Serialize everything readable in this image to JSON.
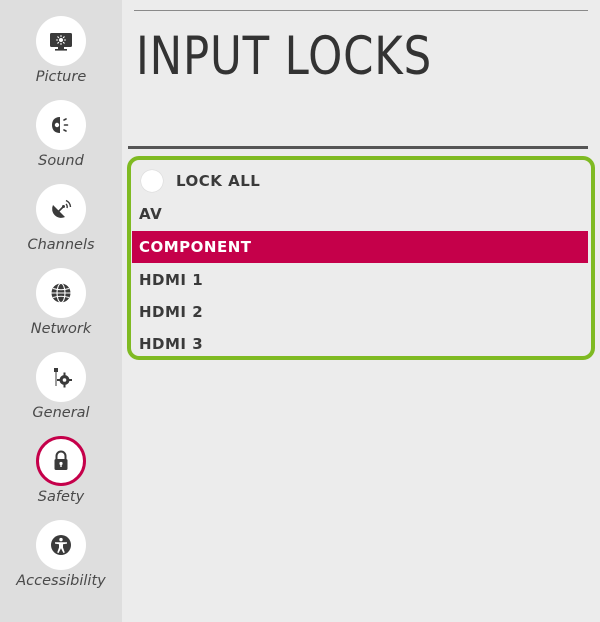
{
  "sidebar": {
    "items": [
      {
        "label": "Picture",
        "icon": "picture-icon",
        "selected": false
      },
      {
        "label": "Sound",
        "icon": "sound-icon",
        "selected": false
      },
      {
        "label": "Channels",
        "icon": "channels-icon",
        "selected": false
      },
      {
        "label": "Network",
        "icon": "network-icon",
        "selected": false
      },
      {
        "label": "General",
        "icon": "general-icon",
        "selected": false
      },
      {
        "label": "Safety",
        "icon": "lock-icon",
        "selected": true
      },
      {
        "label": "Accessibility",
        "icon": "accessibility-icon",
        "selected": false
      }
    ]
  },
  "main": {
    "title": "INPUT LOCKS",
    "lock_all": {
      "label": "LOCK ALL",
      "checked": false
    },
    "inputs": [
      {
        "label": "AV",
        "selected": false
      },
      {
        "label": "COMPONENT",
        "selected": true
      },
      {
        "label": "HDMI 1",
        "selected": false
      },
      {
        "label": "HDMI 2",
        "selected": false
      },
      {
        "label": "HDMI 3",
        "selected": false
      }
    ]
  },
  "colors": {
    "accent": "#c5004a",
    "focus_border": "#7fba22",
    "sidebar_bg": "#dedede",
    "page_bg": "#ececec"
  }
}
